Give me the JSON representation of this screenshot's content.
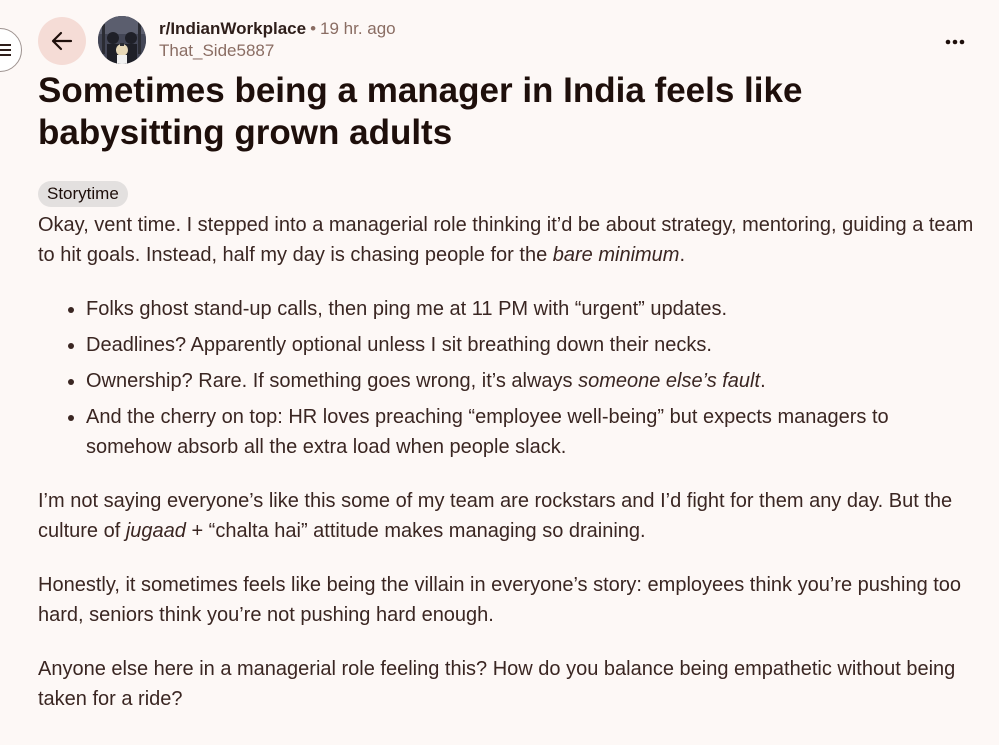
{
  "nav": {
    "menu_icon": "hamburger-icon",
    "back_icon": "arrow-left-icon"
  },
  "post": {
    "subreddit": "r/IndianWorkplace",
    "separator": "•",
    "time": "19 hr. ago",
    "author": "That_Side5887",
    "more_icon": "ellipsis-icon",
    "title": "Sometimes being a manager in India feels like babysitting grown adults",
    "flair": "Storytime",
    "body": {
      "p1_a": "Okay, vent time. I stepped into a managerial role thinking it’d be about strategy, mentoring, guiding a team to hit goals. Instead, half my day is chasing people for the ",
      "p1_em": "bare minimum",
      "p1_b": ".",
      "bullets": {
        "b1": "Folks ghost stand-up calls, then ping me at 11 PM with “urgent” updates.",
        "b2": "Deadlines? Apparently optional unless I sit breathing down their necks.",
        "b3_a": "Ownership? Rare. If something goes wrong, it’s always ",
        "b3_em": "someone else’s fault",
        "b3_b": ".",
        "b4": "And the cherry on top: HR loves preaching “employee well-being” but expects managers to somehow absorb all the extra load when people slack."
      },
      "p2_a": "I’m not saying everyone’s like this some of my team are rockstars and I’d fight for them any day. But the culture of ",
      "p2_em": "jugaad",
      "p2_b": " + “chalta hai” attitude makes managing so draining.",
      "p3": "Honestly, it sometimes feels like being the villain in everyone’s story: employees think you’re pushing too hard, seniors think you’re not pushing hard enough.",
      "p4": "Anyone else here in a managerial role feeling this? How do you balance being empathetic without being taken for a ride?"
    }
  },
  "colors": {
    "background": "#fdf8f6",
    "back_button_bg": "#f5dcd6",
    "meta_text": "#8a6d63",
    "flair_bg": "#e3e0df"
  }
}
